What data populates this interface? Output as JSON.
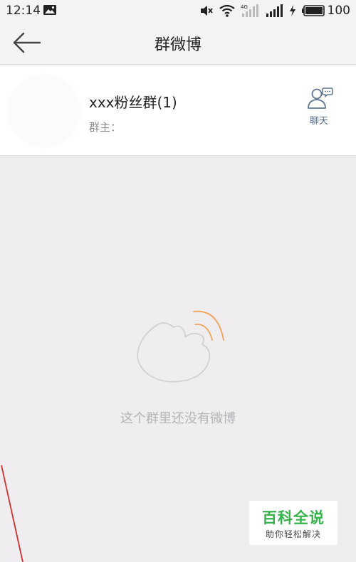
{
  "status_bar": {
    "time": "12:14",
    "battery_level": "100",
    "icons": [
      "image-icon",
      "mute-icon",
      "wifi-icon",
      "signal-4g-icon",
      "signal-icon",
      "charging-icon",
      "battery-icon"
    ]
  },
  "header": {
    "title": "群微博",
    "back_icon": "arrow-left-icon"
  },
  "group": {
    "name": "xxx粉丝群(1)",
    "owner_label": "群主：",
    "chat_label": "聊天",
    "chat_icon": "user-chat-icon"
  },
  "empty_state": {
    "message": "这个群里还没有微博",
    "icon": "weibo-logo-icon"
  },
  "watermark": {
    "main": "百科全说",
    "sub": "助你轻松解决"
  },
  "colors": {
    "background": "#efedf0",
    "bar_background": "#f5f3f6",
    "accent_orange": "#f2a35b",
    "watermark_green": "#36b24b",
    "annotation_red": "#d0312d"
  }
}
